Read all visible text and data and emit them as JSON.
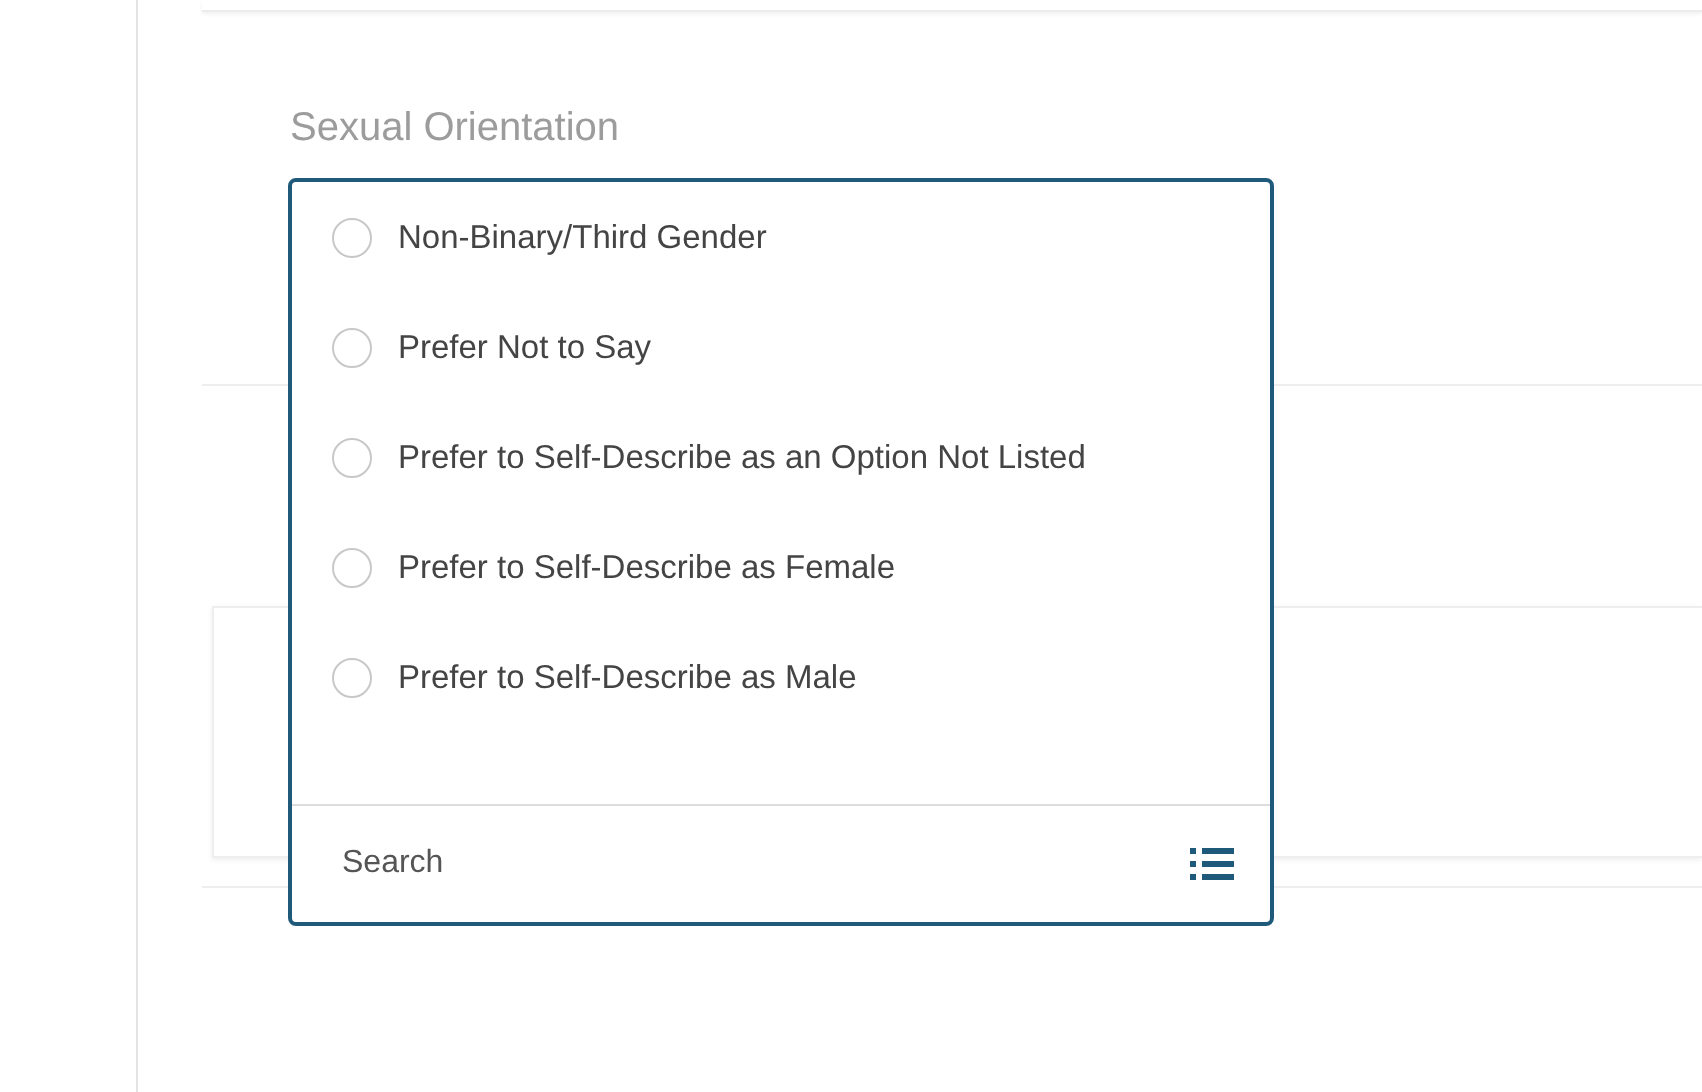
{
  "field": {
    "label": "Sexual Orientation"
  },
  "dropdown": {
    "options": [
      {
        "label": "Non-Binary/Third Gender",
        "selected": false
      },
      {
        "label": "Prefer Not to Say",
        "selected": false
      },
      {
        "label": "Prefer to Self-Describe as an Option Not Listed",
        "selected": false
      },
      {
        "label": "Prefer to Self-Describe as Female",
        "selected": false
      },
      {
        "label": "Prefer to Self-Describe as Male",
        "selected": false
      }
    ],
    "search": {
      "placeholder": "Search"
    }
  }
}
